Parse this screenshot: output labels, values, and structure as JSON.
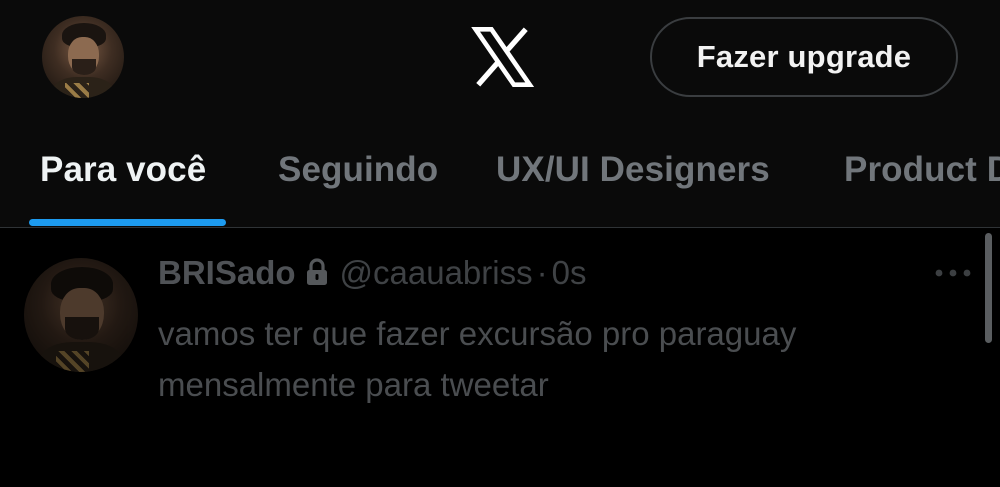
{
  "header": {
    "avatar_icon": "user-avatar",
    "logo_icon": "x-logo-icon",
    "upgrade_label": "Fazer upgrade"
  },
  "tabs": [
    {
      "label": "Para você",
      "active": true
    },
    {
      "label": "Seguindo",
      "active": false
    },
    {
      "label": "UX/UI Designers",
      "active": false
    },
    {
      "label": "Product Designers",
      "active": false
    }
  ],
  "tweet": {
    "display_name": "BRISado",
    "handle": "@caauabriss",
    "separator": "·",
    "time": "0s",
    "text_line1": "vamos ter que fazer excursão pro paraguay",
    "text_line2": "mensalmente para tweetar",
    "lock_icon": "lock-icon",
    "more_icon": "more-options-icon"
  },
  "colors": {
    "background": "#000000",
    "accent": "#1d9bf0",
    "tab_inactive": "#71767b",
    "text_primary": "#eff3f4"
  }
}
